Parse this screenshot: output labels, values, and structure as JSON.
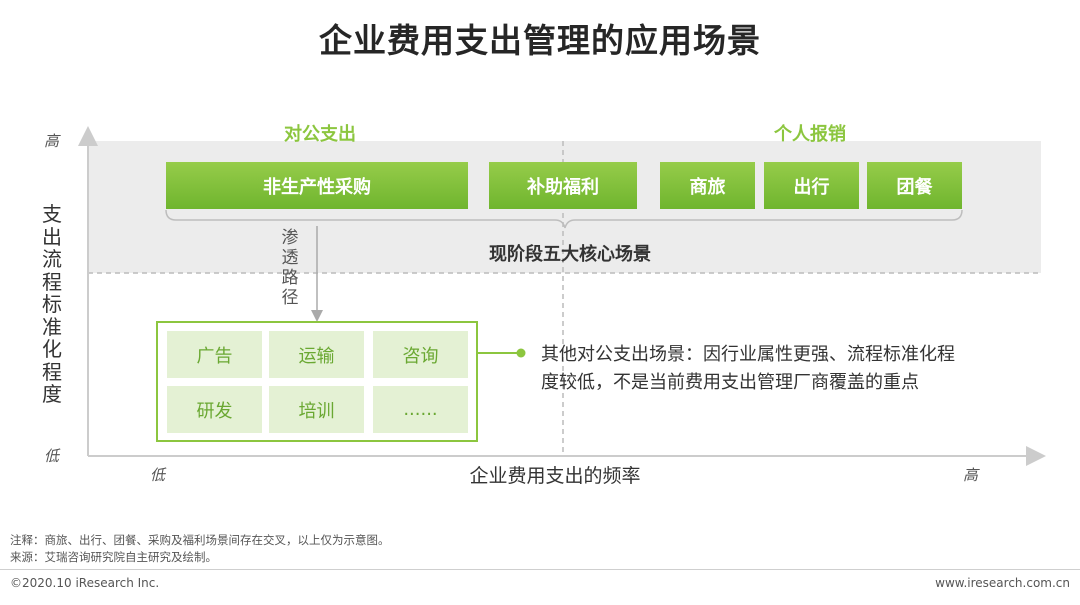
{
  "title": "企业费用支出管理的应用场景",
  "axes": {
    "y_title": "支出流程标准化程度",
    "y_high": "高",
    "y_low": "低",
    "x_title": "企业费用支出的频率",
    "x_low": "低",
    "x_high": "高"
  },
  "groups": {
    "corporate": "对公支出",
    "personal": "个人报销"
  },
  "core_scenes": [
    {
      "label": "非生产性采购"
    },
    {
      "label": "补助福利"
    },
    {
      "label": "商旅"
    },
    {
      "label": "出行"
    },
    {
      "label": "团餐"
    }
  ],
  "core_label": "现阶段五大核心场景",
  "path_label": "渗透路径",
  "other_scenes": [
    {
      "label": "广告"
    },
    {
      "label": "运输"
    },
    {
      "label": "咨询"
    },
    {
      "label": "研发"
    },
    {
      "label": "培训"
    },
    {
      "label": "......"
    }
  ],
  "other_description": "其他对公支出场景：因行业属性更强、流程标准化程度较低，不是当前费用支出管理厂商覆盖的重点",
  "footer": {
    "note": "注释：商旅、出行、团餐、采购及福利场景间存在交叉，以上仅为示意图。",
    "source": "来源：艾瑞咨询研究院自主研究及绘制。",
    "copyright": "©2020.10 iResearch Inc.",
    "website": "www.iresearch.com.cn"
  },
  "colors": {
    "accent_green": "#8cc63f",
    "box_green_dark": "#6fb52e",
    "light_green": "#e4f1d4",
    "band_gray": "#ececec"
  }
}
